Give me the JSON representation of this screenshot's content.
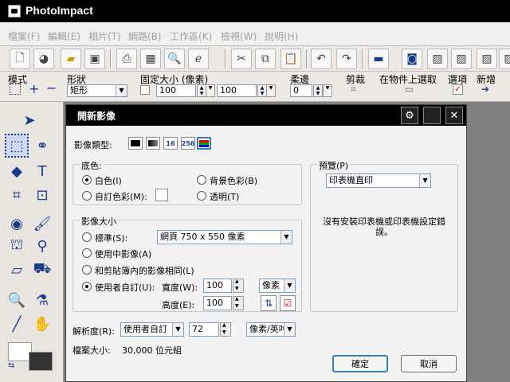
{
  "app": {
    "title": "PhotoImpact"
  },
  "menu": [
    "檔案(F)",
    "編輯(E)",
    "相片(T)",
    "網路(B)",
    "工作區(K)",
    "檢視(W)",
    "說明(H)"
  ],
  "attr": {
    "mode_label": "模式",
    "shape_label": "形狀",
    "shape_value": "矩形",
    "fixed_size_label": "固定大小 (像素)",
    "width_value": "100",
    "height_value": "100",
    "soft_edge_label": "柔邊",
    "soft_edge_value": "0",
    "crop_label": "剪裁",
    "select_on_object_label": "在物件上選取",
    "options_label": "選項",
    "add_label": "新增"
  },
  "dialog": {
    "title": "開新影像",
    "image_type_label": "影像類型:",
    "image_type_16": "16",
    "image_type_256": "256",
    "background_group": "底色:",
    "bg_white": "白色(I)",
    "bg_custom": "自訂色彩(M):",
    "bg_background": "背景色彩(B)",
    "bg_transparent": "透明(T)",
    "size_group": "影像大小",
    "size_standard": "標準(S):",
    "size_standard_value": "網頁 750 x 550 像素",
    "size_active": "使用中影像(A)",
    "size_clipboard": "和剪貼簿內的影像相同(L)",
    "size_user": "使用者自訂(U):",
    "width_label": "寬度(W):",
    "width_value": "100",
    "height_label": "高度(E):",
    "height_value": "100",
    "unit_value": "像素",
    "resolution_label": "解析度(R):",
    "resolution_mode": "使用者自訂",
    "resolution_value": "72",
    "resolution_unit": "像素/英吋",
    "file_size_label": "檔案大小:",
    "file_size_value": "30,000 位元組",
    "preview_group": "預覽(P)",
    "preview_mode": "印表機直印",
    "preview_message": "沒有安裝印表機或印表機設定錯誤。",
    "ok": "確定",
    "cancel": "取消"
  }
}
